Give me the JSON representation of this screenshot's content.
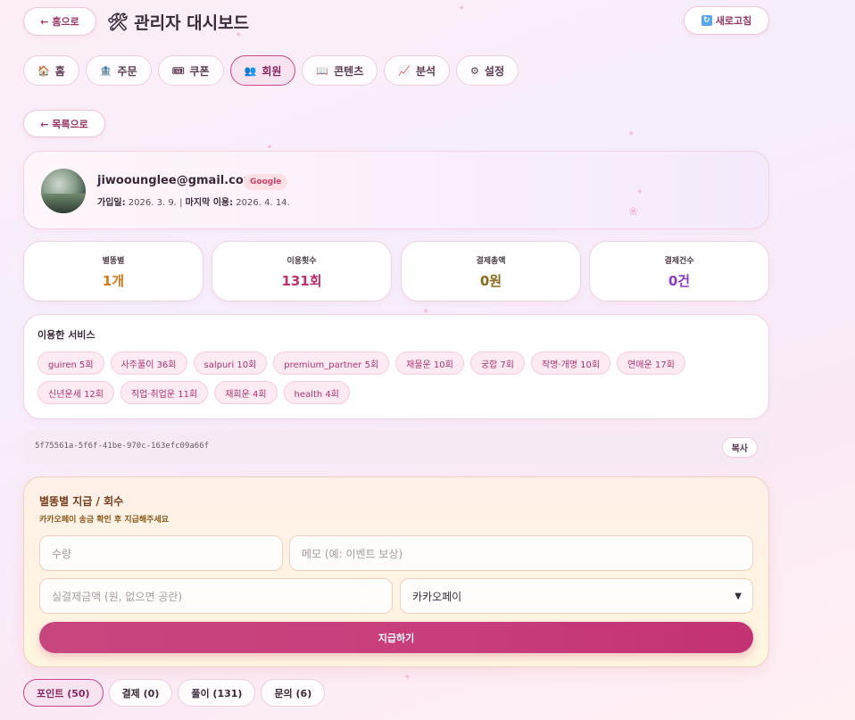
{
  "header": {
    "home_label": "← 홈으로",
    "title_icon": "hammer-wrench-icon",
    "title": "관리자 대시보드",
    "refresh_label": "새로고침"
  },
  "nav_tabs": [
    {
      "icon": "🏠",
      "label": "홈"
    },
    {
      "icon": "🏦",
      "label": "주문"
    },
    {
      "icon": "🎟",
      "label": "쿠폰"
    },
    {
      "icon": "👥",
      "label": "회원",
      "active": true
    },
    {
      "icon": "📖",
      "label": "콘텐츠"
    },
    {
      "icon": "📈",
      "label": "분석"
    },
    {
      "icon": "⚙",
      "label": "설정"
    }
  ],
  "back_to_list": "← 목록으로",
  "profile": {
    "email": "jiwoounglee@gmail.com",
    "provider_badge": "Google",
    "joined_label": "가입일:",
    "joined_value": "2026. 3. 9.",
    "separator": "|",
    "last_used_label": "마지막 이용:",
    "last_used_value": "2026. 4. 14."
  },
  "stats": [
    {
      "label": "별똥별",
      "value": "1개",
      "color": "#d9781a"
    },
    {
      "label": "이용횟수",
      "value": "131회",
      "color": "#c0306e"
    },
    {
      "label": "결제총액",
      "value": "0원",
      "color": "#8a6a1a"
    },
    {
      "label": "결제건수",
      "value": "0건",
      "color": "#8a3cc8"
    }
  ],
  "services": {
    "title": "이용한 서비스",
    "items": [
      "guiren 5회",
      "사주풀이 36회",
      "salpuri 10회",
      "premium_partner 5회",
      "재물운 10회",
      "궁합 7회",
      "작명·개명 10회",
      "연애운 17회",
      "신년운세 12회",
      "직업·취업운 11회",
      "재회운 4회",
      "health 4회"
    ]
  },
  "user_id": "5f75561a-5f6f-41be-970c-163efc09a66f",
  "copy_label": "복사",
  "grant": {
    "title": "별똥별 지급 / 회수",
    "subtitle": "카카오페이 송금 확인 후 지급해주세요",
    "quantity_placeholder": "수량",
    "memo_placeholder": "메모 (예: 이벤트 보상)",
    "amount_placeholder": "실결제금액 (원, 없으면 공란)",
    "payment_method_selected": "카카오페이",
    "submit_label": "지급하기"
  },
  "bottom_tabs": [
    {
      "label": "포인트 (50)",
      "active": true
    },
    {
      "label": "결제 (0)"
    },
    {
      "label": "풀이 (131)"
    },
    {
      "label": "문의 (6)"
    }
  ],
  "colors": {
    "accent": "#c8467e",
    "chip_bg": "#fdeaf3",
    "chip_text": "#b0326e"
  }
}
